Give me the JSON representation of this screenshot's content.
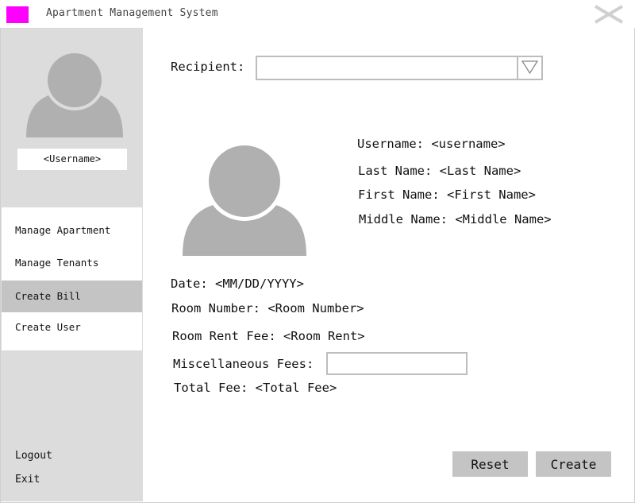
{
  "window": {
    "title": "Apartment Management System",
    "logo_color": "#ff00ff",
    "close_icon": "close-icon"
  },
  "sidebar": {
    "avatar_icon": "user-avatar-icon",
    "username": "<Username>",
    "nav_items": [
      {
        "label": "Manage Apartment",
        "active": false
      },
      {
        "label": "Manage Tenants",
        "active": false
      },
      {
        "label": "Create Bill",
        "active": true
      },
      {
        "label": "Create User",
        "active": false
      }
    ],
    "logout_label": "Logout",
    "exit_label": "Exit"
  },
  "form": {
    "recipient_label": "Recipient:",
    "recipient_value": "",
    "dropdown_icon": "triangle-down-icon",
    "avatar_icon": "user-avatar-icon",
    "username_text": "Username: <username>",
    "last_name_text": "Last Name: <Last Name>",
    "first_name_text": "First Name: <First Name>",
    "middle_name_text": "Middle Name: <Middle Name>",
    "date_text": "Date: <MM/DD/YYYY>",
    "room_number_text": "Room Number: <Room Number>",
    "room_rent_text": "Room Rent Fee: <Room Rent>",
    "misc_fees_label": "Miscellaneous Fees:",
    "misc_fees_value": "",
    "total_fee_text": "Total Fee: <Total Fee>",
    "reset_label": "Reset",
    "create_label": "Create"
  },
  "colors": {
    "sidebar_bg": "#dcdcdc",
    "active_item_bg": "#c4c4c4",
    "button_bg": "#c4c4c4",
    "avatar_fill": "#b0b0b0",
    "border": "#bdbdbd"
  }
}
